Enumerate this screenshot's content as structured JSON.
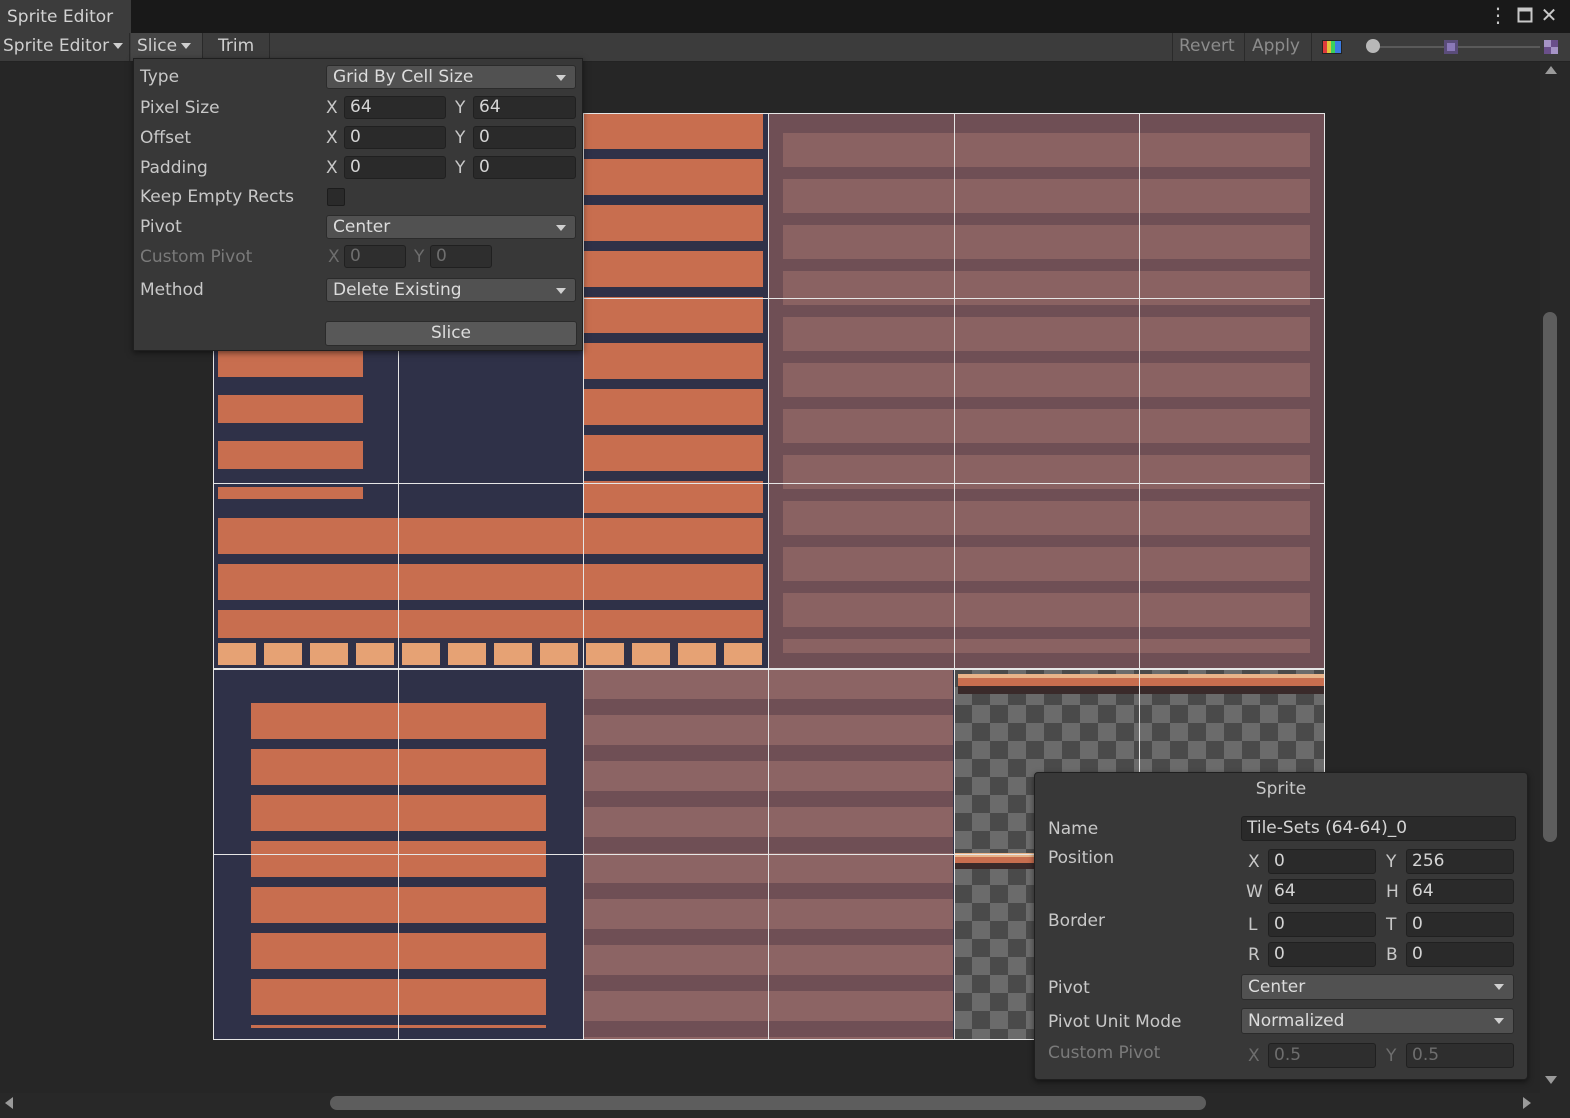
{
  "window": {
    "tab_title": "Sprite Editor"
  },
  "toolbar": {
    "mode_label": "Sprite Editor",
    "slice_label": "Slice",
    "trim_label": "Trim",
    "revert_label": "Revert",
    "apply_label": "Apply"
  },
  "slice": {
    "type_label": "Type",
    "type_value": "Grid By Cell Size",
    "pixel_size_label": "Pixel Size",
    "pixel_x": "64",
    "pixel_y": "64",
    "offset_label": "Offset",
    "offset_x": "0",
    "offset_y": "0",
    "padding_label": "Padding",
    "padding_x": "0",
    "padding_y": "0",
    "keep_empty_label": "Keep Empty Rects",
    "pivot_label": "Pivot",
    "pivot_value": "Center",
    "custom_pivot_label": "Custom Pivot",
    "custom_pivot_x": "0",
    "custom_pivot_y": "0",
    "method_label": "Method",
    "method_value": "Delete Existing",
    "slice_button": "Slice",
    "x_axis": "X",
    "y_axis": "Y"
  },
  "sprite": {
    "header": "Sprite",
    "name_label": "Name",
    "name_value": "Tile-Sets (64-64)_0",
    "position_label": "Position",
    "x_label": "X",
    "x_value": "0",
    "y_label": "Y",
    "y_value": "256",
    "w_label": "W",
    "w_value": "64",
    "h_label": "H",
    "h_value": "64",
    "border_label": "Border",
    "l_label": "L",
    "l_value": "0",
    "t_label": "T",
    "t_value": "0",
    "r_label": "R",
    "r_value": "0",
    "b_label": "B",
    "b_value": "0",
    "pivot_label": "Pivot",
    "pivot_value": "Center",
    "pivot_unit_label": "Pivot Unit Mode",
    "pivot_unit_value": "Normalized",
    "custom_pivot_label": "Custom Pivot",
    "cp_x_label": "X",
    "cp_x_value": "0.5",
    "cp_y_label": "Y",
    "cp_y_value": "0.5"
  },
  "colors": {
    "accent": "#d97a55",
    "dim_tile": "#7e5a5a",
    "sheet_bg": "#2f3148"
  }
}
